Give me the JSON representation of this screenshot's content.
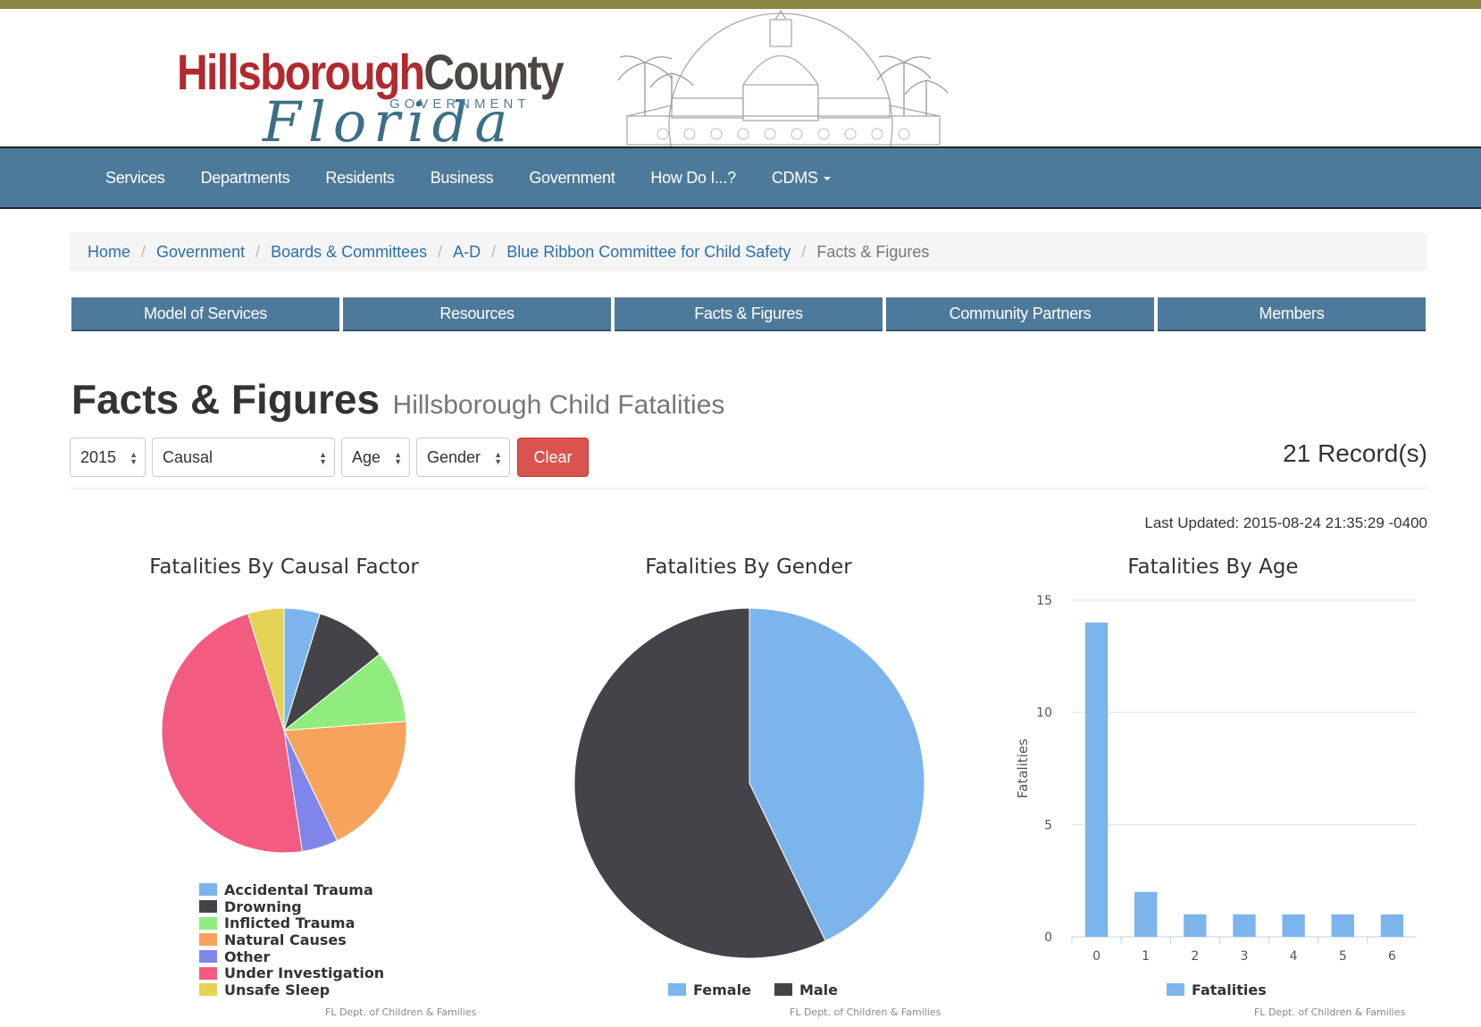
{
  "header": {
    "logo": {
      "part1": "Hillsborough",
      "part2": "County",
      "sub": "GOVERNMENT",
      "script": "Florida"
    }
  },
  "nav": {
    "items": [
      "Services",
      "Departments",
      "Residents",
      "Business",
      "Government",
      "How Do I...?",
      "CDMS"
    ]
  },
  "breadcrumb": {
    "items": [
      "Home",
      "Government",
      "Boards & Committees",
      "A-D",
      "Blue Ribbon Committee for Child Safety"
    ],
    "active": "Facts & Figures"
  },
  "subnav": {
    "items": [
      "Model of Services",
      "Resources",
      "Facts & Figures",
      "Community Partners",
      "Members"
    ]
  },
  "page": {
    "title": "Facts & Figures",
    "subtitle": "Hillsborough Child Fatalities"
  },
  "filters": {
    "year": "2015",
    "causal": "Causal",
    "age": "Age",
    "gender": "Gender",
    "clear_label": "Clear"
  },
  "records": "21 Record(s)",
  "last_updated": "Last Updated: 2015-08-24 21:35:29 -0400",
  "colors": {
    "nav_bg": "#4d7a9b",
    "stripe": "#8b8543",
    "clear": "#d9534f",
    "link": "#2a6fb0"
  },
  "chart_data": [
    {
      "type": "pie",
      "title": "Fatalities By Causal Factor",
      "credit": "FL Dept. of Children & Families",
      "legend_position": "bottom",
      "series": [
        {
          "name": "Accidental Trauma",
          "value": 1,
          "color": "#7cb5ec"
        },
        {
          "name": "Drowning",
          "value": 2,
          "color": "#434348"
        },
        {
          "name": "Inflicted Trauma",
          "value": 2,
          "color": "#90ed7d"
        },
        {
          "name": "Natural Causes",
          "value": 4,
          "color": "#f7a35c"
        },
        {
          "name": "Other",
          "value": 1,
          "color": "#8085e9"
        },
        {
          "name": "Under Investigation",
          "value": 10,
          "color": "#f15c80"
        },
        {
          "name": "Unsafe Sleep",
          "value": 1,
          "color": "#e4d354"
        }
      ]
    },
    {
      "type": "pie",
      "title": "Fatalities By Gender",
      "credit": "FL Dept. of Children & Families",
      "legend_position": "bottom",
      "series": [
        {
          "name": "Female",
          "value": 9,
          "color": "#7cb5ec"
        },
        {
          "name": "Male",
          "value": 12,
          "color": "#434348"
        }
      ]
    },
    {
      "type": "bar",
      "title": "Fatalities By Age",
      "credit": "FL Dept. of Children & Families",
      "ylabel": "Fatalities",
      "categories": [
        "0",
        "1",
        "2",
        "3",
        "4",
        "5",
        "6"
      ],
      "series": [
        {
          "name": "Fatalities",
          "values": [
            14,
            2,
            1,
            1,
            1,
            1,
            1
          ],
          "color": "#7cb5ec"
        }
      ],
      "ylim": [
        0,
        15
      ],
      "yticks": [
        0,
        5,
        10,
        15
      ],
      "grid": true,
      "legend_position": "bottom"
    }
  ]
}
